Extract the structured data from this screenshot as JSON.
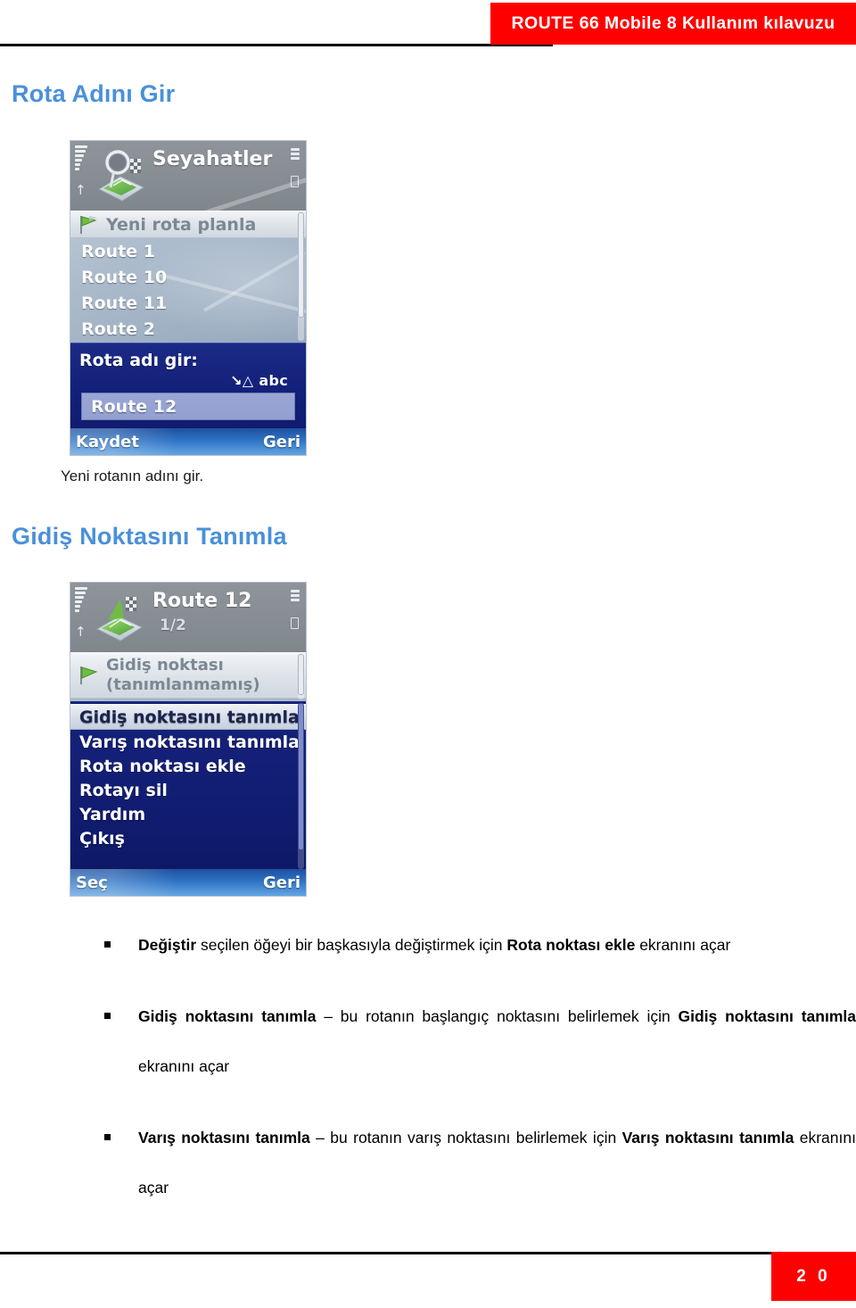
{
  "header": {
    "banner_title": "ROUTE 66 Mobile 8 Kullanım kılavuzu",
    "banner_color": "#FF0000",
    "banner_text_color": "#FFFFFF"
  },
  "footer": {
    "page_number": "2 0",
    "page_box_color": "#FF0000"
  },
  "headings": {
    "heading_1": "Rota Adını Gir",
    "heading_2": "Gidiş Noktasını Tanımla",
    "heading_color": "#4A90D9"
  },
  "captions": {
    "caption_1": "Yeni rotanın adını gir."
  },
  "screenshot_1": {
    "titlebar": {
      "title": "Seyahatler",
      "subtitle": "",
      "app_icon": "map-magnifier-icon",
      "signal_icon": "signal-bars-icon",
      "battery_icon": "battery-icon"
    },
    "list": [
      {
        "label": "Yeni rota planla",
        "selected": true,
        "icon": "green-flag-icon"
      },
      {
        "label": "Route 1",
        "selected": false
      },
      {
        "label": "Route 10",
        "selected": false
      },
      {
        "label": "Route 11",
        "selected": false
      },
      {
        "label": "Route 2",
        "selected": false
      }
    ],
    "dialog": {
      "prompt": "Rota adı gir:",
      "input_mode": "abc",
      "input_mode_icon": "input-mode-arrow-icon",
      "input_value": "Route 12"
    },
    "softkeys": {
      "left": "Kaydet",
      "right": "Geri"
    }
  },
  "screenshot_2": {
    "titlebar": {
      "title": "Route 12",
      "subtitle": "1/2",
      "app_icon": "route-flag-icon",
      "signal_icon": "signal-bars-icon",
      "battery_icon": "battery-icon"
    },
    "list": [
      {
        "label_line1": "Gidiş noktası",
        "label_line2": "(tanımlanmamış)",
        "selected": true,
        "icon": "green-flag-icon"
      }
    ],
    "menu": [
      {
        "label": "Gidiş noktasını tanımla",
        "selected": true
      },
      {
        "label": "Varış noktasını tanımla",
        "selected": false
      },
      {
        "label": "Rota noktası ekle",
        "selected": false
      },
      {
        "label": "Rotayı sil",
        "selected": false
      },
      {
        "label": "Yardım",
        "selected": false
      },
      {
        "label": "Çıkış",
        "selected": false
      }
    ],
    "softkeys": {
      "left": "Seç",
      "right": "Geri"
    }
  },
  "bullets": [
    {
      "parts": [
        {
          "text": "Değiştir ",
          "bold": true
        },
        {
          "text": "seçilen öğeyi bir başkasıyla değiştirmek için ",
          "bold": false
        },
        {
          "text": "Rota noktası ekle ",
          "bold": true
        },
        {
          "text": "ekranını açar",
          "bold": false
        }
      ]
    },
    {
      "parts": [
        {
          "text": "Gidiş noktasını tanımla ",
          "bold": true
        },
        {
          "text": "– bu rotanın başlangıç noktasını belirlemek için ",
          "bold": false
        },
        {
          "text": "Gidiş noktasını tanımla ",
          "bold": true
        },
        {
          "text": "ekranını açar",
          "bold": false
        }
      ]
    },
    {
      "parts": [
        {
          "text": "Varış noktasını tanımla ",
          "bold": true
        },
        {
          "text": "– bu rotanın varış noktasını belirlemek için ",
          "bold": false
        },
        {
          "text": "Varış noktasını tanımla ",
          "bold": true
        },
        {
          "text": "ekranını açar",
          "bold": false
        }
      ]
    }
  ]
}
